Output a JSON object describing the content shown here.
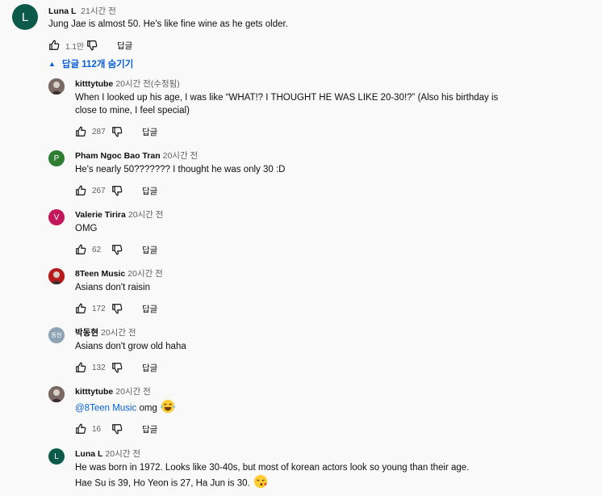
{
  "top_comment": {
    "avatar_letter": "L",
    "avatar_color": "#0b5a4a",
    "author": "Luna L",
    "time": "21시간 전",
    "text": "Jung Jae is almost 50. He's like fine wine as he gets older.",
    "likes": "1.1만",
    "reply_label": "답글"
  },
  "replies_toggle": {
    "label": "답글 112개 숨기기",
    "icon": "caret-up-icon"
  },
  "replies": [
    {
      "author": "kitttytube",
      "time": "20시간 전(수정됨)",
      "avatar_letter": "",
      "avatar_color": "#7a6a66",
      "text_lines": [
        "When I looked up his age, I was like “WHAT!? I THOUGHT HE WAS LIKE 20-30!?” (Also his birthday is",
        "close to mine, I feel special)"
      ],
      "likes": "287",
      "reply_label": "답글"
    },
    {
      "author": "Pham Ngoc Bao Tran",
      "time": "20시간 전",
      "avatar_letter": "P",
      "avatar_color": "#2e7d32",
      "text_lines": [
        "He's nearly 50??????? I thought he was only 30 :D"
      ],
      "likes": "267",
      "reply_label": "답글"
    },
    {
      "author": "Valerie Tirira",
      "time": "20시간 전",
      "avatar_letter": "V",
      "avatar_color": "#c2185b",
      "text_lines": [
        "OMG"
      ],
      "likes": "62",
      "reply_label": "답글"
    },
    {
      "author": "8Teen Music",
      "time": "20시간 전",
      "avatar_letter": "",
      "avatar_color": "#b71c1c",
      "text_lines": [
        "Asians don't raisin"
      ],
      "likes": "172",
      "reply_label": "답글"
    },
    {
      "author": "박동현",
      "time": "20시간 전",
      "avatar_letter": "동현",
      "avatar_color": "#8da3b3",
      "text_lines": [
        "Asians don't grow old haha"
      ],
      "likes": "132",
      "reply_label": "답글"
    },
    {
      "author": "kitttytube",
      "time": "20시간 전",
      "avatar_letter": "",
      "avatar_color": "#7a6a66",
      "mention": "@8Teen Music",
      "text_lines": [
        "omg"
      ],
      "emoji": "laughing-emoji",
      "likes": "16",
      "reply_label": "답글"
    },
    {
      "author": "Luna L",
      "time": "20시간 전",
      "avatar_letter": "L",
      "avatar_color": "#0b5a4a",
      "text_lines": [
        "He was born in 1972. Looks like 30-40s, but most of korean actors look so young than their age.",
        "Hae Su is 39, Ho Yeon is 27, Ha Jun is 30."
      ],
      "emoji": "kiss-emoji",
      "likes": "",
      "reply_label": ""
    }
  ]
}
